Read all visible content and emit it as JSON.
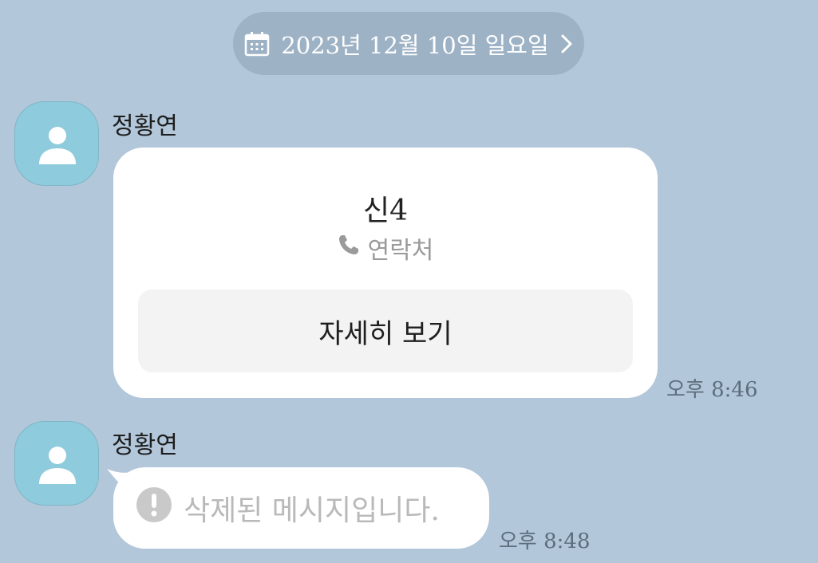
{
  "date_header": {
    "label": "2023년 12월 10일 일요일"
  },
  "messages": [
    {
      "sender": "정황연",
      "card": {
        "title": "신4",
        "subtitle": "연락처",
        "button_label": "자세히 보기"
      },
      "time": "오후 8:46"
    },
    {
      "sender": "정황연",
      "text": "삭제된 메시지입니다.",
      "time": "오후 8:48"
    }
  ],
  "colors": {
    "background": "#b2c7da",
    "date_pill": "#9eb2c5",
    "avatar": "#8ecbdc",
    "bubble": "#ffffff",
    "deleted_text": "#b9b9b9"
  },
  "icons": [
    "calendar-icon",
    "chevron-right-icon",
    "person-icon",
    "phone-icon",
    "exclamation-icon"
  ]
}
